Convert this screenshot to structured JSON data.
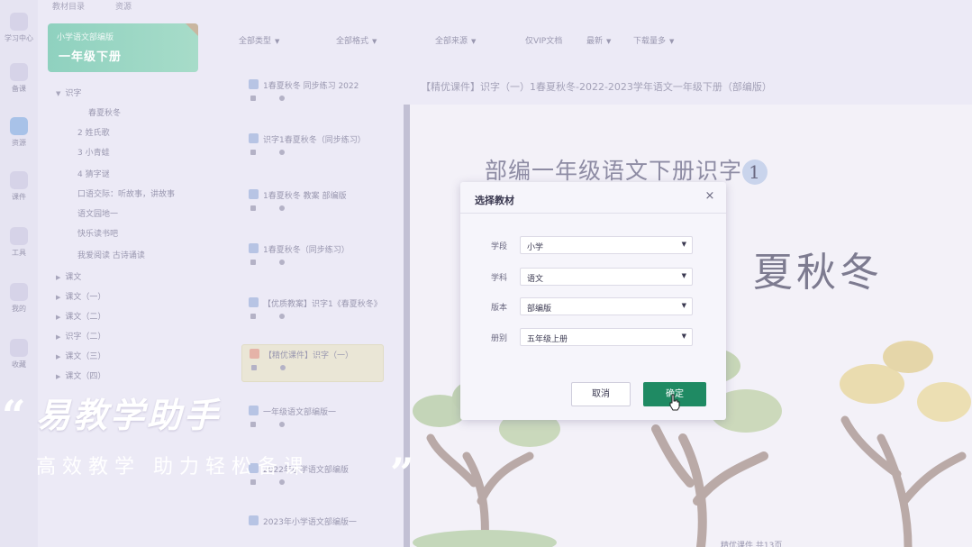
{
  "rail": [
    {
      "label": "学习中心"
    },
    {
      "label": "备课"
    },
    {
      "label": "资源"
    },
    {
      "label": "课件"
    },
    {
      "label": "工具"
    },
    {
      "label": "我的"
    },
    {
      "label": "收藏"
    }
  ],
  "top_tabs": [
    "教材目录",
    "资源"
  ],
  "book_card": {
    "line1": "小学语文部编版",
    "line2": "一年级下册"
  },
  "tree": [
    {
      "label": "识字"
    },
    {
      "label": "春夏秋冬"
    },
    {
      "label": "2 姓氏歌"
    },
    {
      "label": "3 小青蛙"
    },
    {
      "label": "4 猜字谜"
    },
    {
      "label": "口语交际：听故事，讲故事"
    },
    {
      "label": "语文园地一"
    },
    {
      "label": "快乐读书吧"
    },
    {
      "label": "我爱阅读 古诗诵读"
    },
    {
      "label": "课文"
    },
    {
      "label": "课文（一）"
    },
    {
      "label": "课文（二）"
    },
    {
      "label": "识字（二）"
    },
    {
      "label": "课文（三）"
    },
    {
      "label": "课文（四）"
    }
  ],
  "filters": [
    {
      "label": "全部类型"
    },
    {
      "label": "全部格式"
    },
    {
      "label": "全部来源"
    },
    {
      "label": "仅VIP文档"
    },
    {
      "label": "最新"
    },
    {
      "label": "下载量多"
    }
  ],
  "resources": [
    {
      "title": "1春夏秋冬 同步练习 2022",
      "type": "doc"
    },
    {
      "title": "识字1春夏秋冬（同步练习）",
      "type": "doc"
    },
    {
      "title": "1春夏秋冬 教案 部编版",
      "type": "doc"
    },
    {
      "title": "1春夏秋冬（同步练习）",
      "type": "doc"
    },
    {
      "title": "【优质教案】识字1《春夏秋冬》",
      "type": "doc"
    },
    {
      "title": "【精优课件】识字（一）",
      "type": "ppt"
    },
    {
      "title": "一年级语文部编版一",
      "type": "doc"
    },
    {
      "title": "2022年小学语文部编版",
      "type": "doc"
    },
    {
      "title": "2023年小学语文部编版一",
      "type": "doc"
    }
  ],
  "preview": {
    "title": "【精优课件】识字（一）1春夏秋冬-2022-2023学年语文一年级下册（部编版）",
    "heading": "部编一年级语文下册识字",
    "heading_number": "1",
    "big_text": "夏秋冬"
  },
  "bottom_bar": "精优课件 共13页",
  "dialog": {
    "title": "选择教材",
    "close": "×",
    "fields": [
      {
        "label": "学段",
        "value": "小学"
      },
      {
        "label": "学科",
        "value": "语文"
      },
      {
        "label": "版本",
        "value": "部编版"
      },
      {
        "label": "册别",
        "value": "五年级上册"
      }
    ],
    "cancel": "取消",
    "confirm": "确定"
  },
  "promo": {
    "quote_open": "“",
    "title": "易教学助手",
    "subtitle": "高效教学 助力轻松备课",
    "quote_close": "”"
  },
  "colors": {
    "confirm": "#1f8a63",
    "card": "#8fd1bf",
    "overlay_text": "#ffffff"
  }
}
